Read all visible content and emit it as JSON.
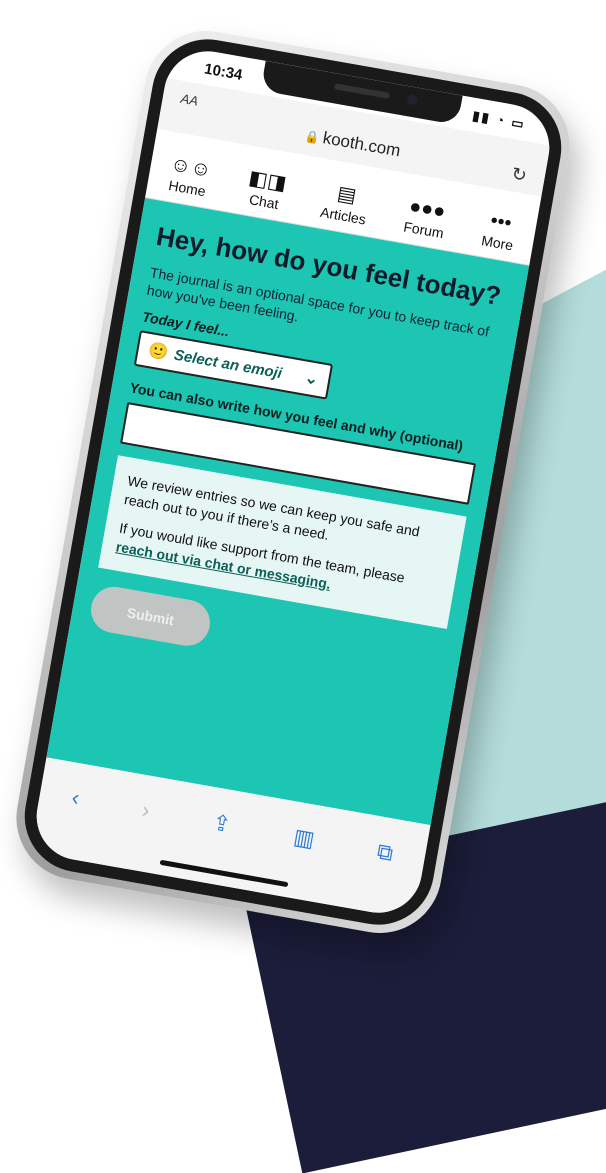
{
  "status": {
    "time": "10:34"
  },
  "browser": {
    "text_size": "AA",
    "url": "kooth.com"
  },
  "nav": [
    {
      "label": "Home",
      "icon": "home-icon"
    },
    {
      "label": "Chat",
      "icon": "chat-icon"
    },
    {
      "label": "Articles",
      "icon": "articles-icon"
    },
    {
      "label": "Forum",
      "icon": "forum-icon"
    },
    {
      "label": "More",
      "icon": "more-icon"
    }
  ],
  "journal": {
    "heading": "Hey, how do you feel today?",
    "intro": "The journal is an optional space for you to keep track of how you've been feeling.",
    "feel_label": "Today I feel...",
    "select_placeholder": "Select an emoji",
    "also_label": "You can also write how you feel and why (optional)",
    "info_p1": "We review entries so we can keep you safe and reach out to you if there’s a need.",
    "info_p2_prefix": "If you would like support from the team, please ",
    "info_link": "reach out via chat or messaging.",
    "submit_label": "Submit"
  },
  "colors": {
    "accent": "#1cc6b2",
    "link": "#0b5f56",
    "submit_disabled": "#c0c5c4"
  }
}
